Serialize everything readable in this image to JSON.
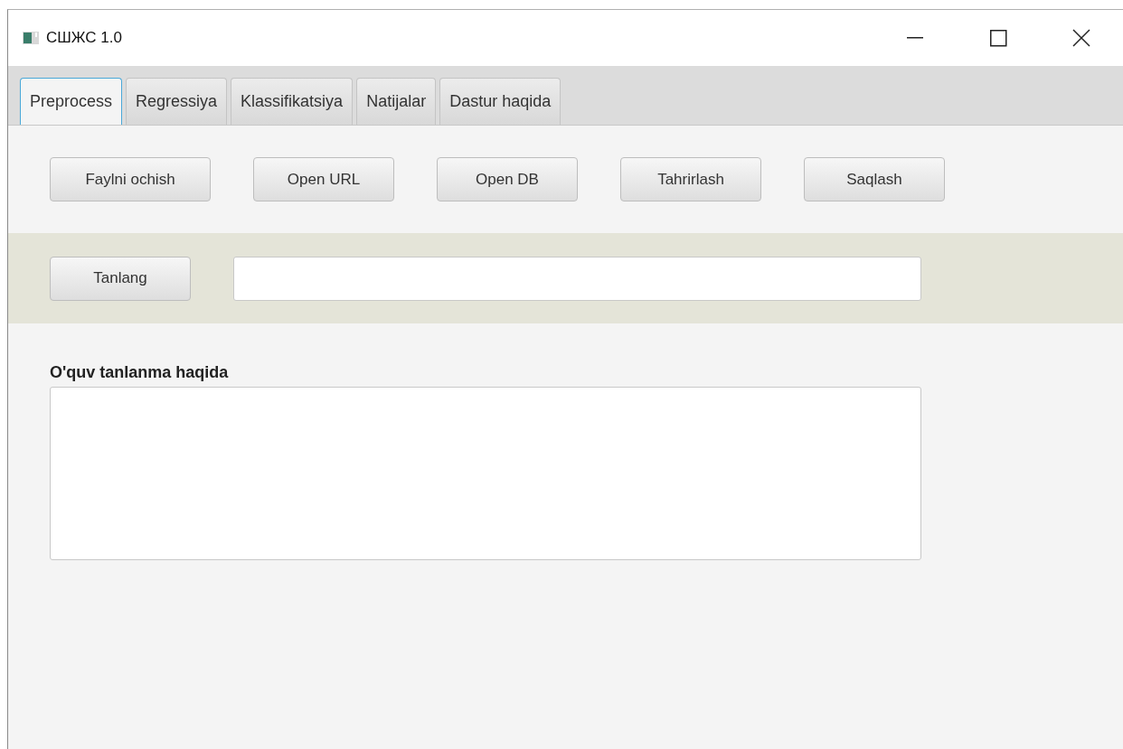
{
  "window": {
    "title": "СШЖС 1.0"
  },
  "tabs": [
    {
      "label": "Preprocess",
      "selected": true
    },
    {
      "label": "Regressiya",
      "selected": false
    },
    {
      "label": "Klassifikatsiya",
      "selected": false
    },
    {
      "label": "Natijalar",
      "selected": false
    },
    {
      "label": "Dastur haqida",
      "selected": false
    }
  ],
  "toolbar": [
    "Faylni ochish",
    "Open URL",
    "Open DB",
    "Tahrirlash",
    "Saqlash"
  ],
  "select_row": {
    "button": "Tanlang"
  },
  "info": {
    "label": "O'quv tanlanma haqida"
  }
}
